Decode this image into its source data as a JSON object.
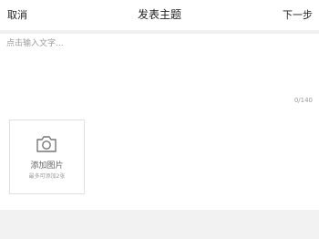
{
  "header": {
    "cancel_label": "取消",
    "title": "发表主题",
    "next_label": "下一步"
  },
  "editor": {
    "placeholder": "点击输入文字...",
    "value": "",
    "char_count": "0/140"
  },
  "photo": {
    "icon": "camera-icon",
    "label": "添加图片",
    "sub_label": "最多可添加2张"
  },
  "colors": {
    "page_background": "#f2f2f2",
    "panel_background": "#ffffff",
    "placeholder_text": "#9a9a9a",
    "icon_stroke": "#777777"
  }
}
